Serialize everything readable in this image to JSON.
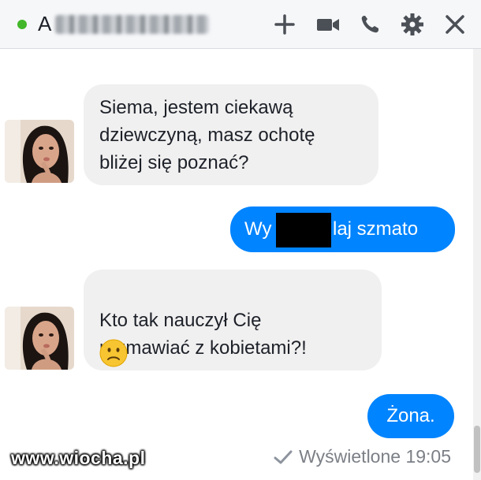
{
  "header": {
    "contact_initial": "A",
    "online_color": "#42b72a",
    "icons": [
      "plus-icon",
      "video-camera-icon",
      "phone-icon",
      "gear-icon",
      "close-icon"
    ]
  },
  "messages": [
    {
      "direction": "incoming",
      "text": "Siema, jestem ciekawą\ndziewczyną, masz ochotę\nbliżej się poznać?"
    },
    {
      "direction": "outgoing",
      "text_start": "Wy",
      "text_end": "laj szmato",
      "redacted": true
    },
    {
      "direction": "incoming",
      "text": "Kto tak nauczył Cię\nrozmawiać z kobietami?!",
      "emoji": "slightly-frowning-face"
    },
    {
      "direction": "outgoing",
      "text": "Żona."
    }
  ],
  "seen": {
    "label": "Wyświetlone 19:05",
    "icon": "checkmark-icon"
  },
  "watermark": {
    "text": "www.wiocha.pl"
  },
  "colors": {
    "outgoing_bubble": "#0084ff",
    "incoming_bubble": "#f1f0f0",
    "header_bg": "#f6f7f9"
  }
}
